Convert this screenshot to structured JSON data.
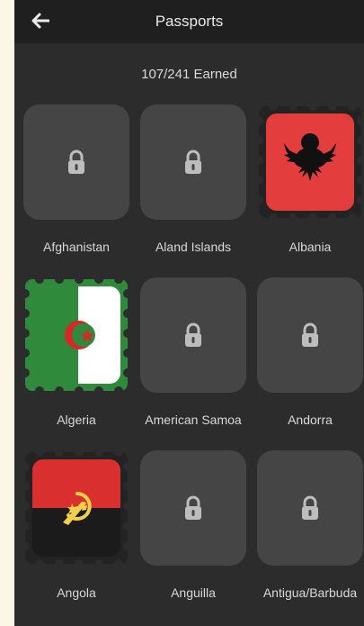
{
  "header": {
    "title": "Passports"
  },
  "summary": {
    "earned": "107/241 Earned"
  },
  "countries": [
    {
      "name": "Afghanistan",
      "earned": false
    },
    {
      "name": "Aland Islands",
      "earned": false
    },
    {
      "name": "Albania",
      "earned": true
    },
    {
      "name": "Algeria",
      "earned": true
    },
    {
      "name": "American Samoa",
      "earned": false
    },
    {
      "name": "Andorra",
      "earned": false
    },
    {
      "name": "Angola",
      "earned": true
    },
    {
      "name": "Anguilla",
      "earned": false
    },
    {
      "name": "Antigua/Barbuda",
      "earned": false
    }
  ],
  "colors": {
    "background": "#2c2c2c",
    "tile": "#454545",
    "page_margin": "#fbf6e6",
    "albania_red": "#e43d3d",
    "algeria_green": "#2f8a3b",
    "angola_red": "#d9302f",
    "angola_black": "#1b1b1b"
  },
  "icons": {
    "back": "arrow-left-icon",
    "locked": "lock-icon"
  }
}
